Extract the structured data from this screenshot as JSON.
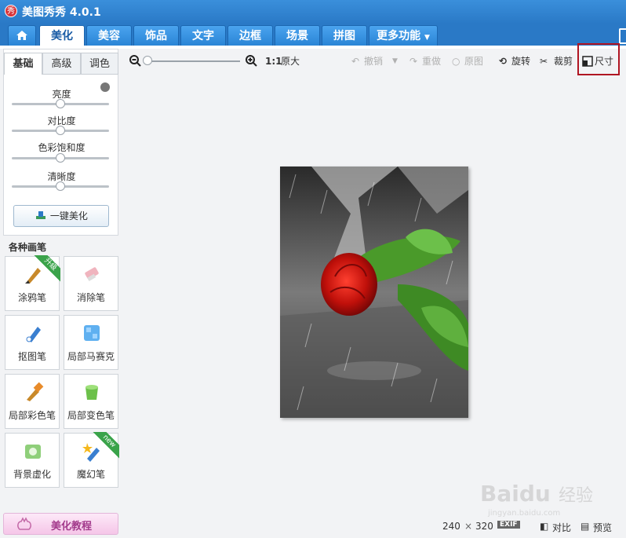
{
  "app": {
    "title": "美图秀秀 4.0.1",
    "logo_char": "秀"
  },
  "tabs": [
    {
      "label": "美化",
      "active": true
    },
    {
      "label": "美容"
    },
    {
      "label": "饰品"
    },
    {
      "label": "文字"
    },
    {
      "label": "边框"
    },
    {
      "label": "场景"
    },
    {
      "label": "拼图"
    },
    {
      "label": "更多功能"
    }
  ],
  "subtabs": [
    "基础",
    "高级",
    "调色"
  ],
  "sliders": [
    {
      "label": "亮度",
      "value": 0.5
    },
    {
      "label": "对比度",
      "value": 0.5
    },
    {
      "label": "色彩饱和度",
      "value": 0.5
    },
    {
      "label": "清晰度",
      "value": 0.5
    }
  ],
  "one_key_label": "一键美化",
  "brushes_title": "各种画笔",
  "brushes": [
    {
      "label": "涂鸦笔",
      "badge": "升级"
    },
    {
      "label": "消除笔"
    },
    {
      "label": "抠图笔"
    },
    {
      "label": "局部马赛克"
    },
    {
      "label": "局部彩色笔"
    },
    {
      "label": "局部变色笔"
    },
    {
      "label": "背景虚化"
    },
    {
      "label": "魔幻笔",
      "badge": "new"
    }
  ],
  "tutorial_label": "美化教程",
  "toolbar": {
    "zoom_ratio": "1:1",
    "original_size": "原大",
    "undo": "撤销",
    "redo": "重做",
    "original": "原图",
    "rotate": "旋转",
    "crop": "裁剪",
    "size": "尺寸"
  },
  "status": {
    "width": "240",
    "times": "×",
    "height": "320",
    "exif": "EXIF",
    "compare": "对比",
    "preview": "预览"
  },
  "watermark": {
    "brand": "Baidu",
    "sub": "经验",
    "url": "jingyan.baidu.com"
  },
  "colors": {
    "accent": "#2a79c6",
    "highlight": "#b01522"
  }
}
